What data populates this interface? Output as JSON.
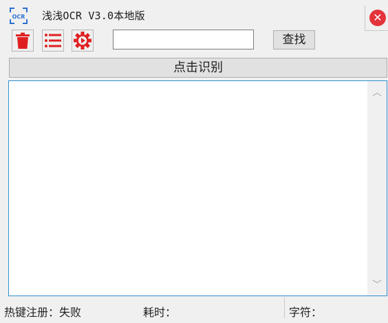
{
  "window": {
    "title": "浅浅OCR V3.0本地版",
    "app_icon_text": "OCR",
    "close_symbol": "✕"
  },
  "toolbar": {
    "icons": [
      "trash-icon",
      "list-icon",
      "settings-gear-icon"
    ],
    "search": {
      "value": "",
      "placeholder": ""
    },
    "search_button_label": "查找"
  },
  "recognize_button_label": "点击识别",
  "output": {
    "text": "",
    "scroll_up_symbol": "︿",
    "scroll_down_symbol": "﹀"
  },
  "status": {
    "hotkey": "热键注册：失败",
    "elapsed": "耗时：",
    "chars": "字符："
  },
  "colors": {
    "accent_red": "#e02020",
    "close_red": "#e4333a",
    "icon_blue": "#2b6fd0",
    "textarea_border": "#2f8fce"
  }
}
